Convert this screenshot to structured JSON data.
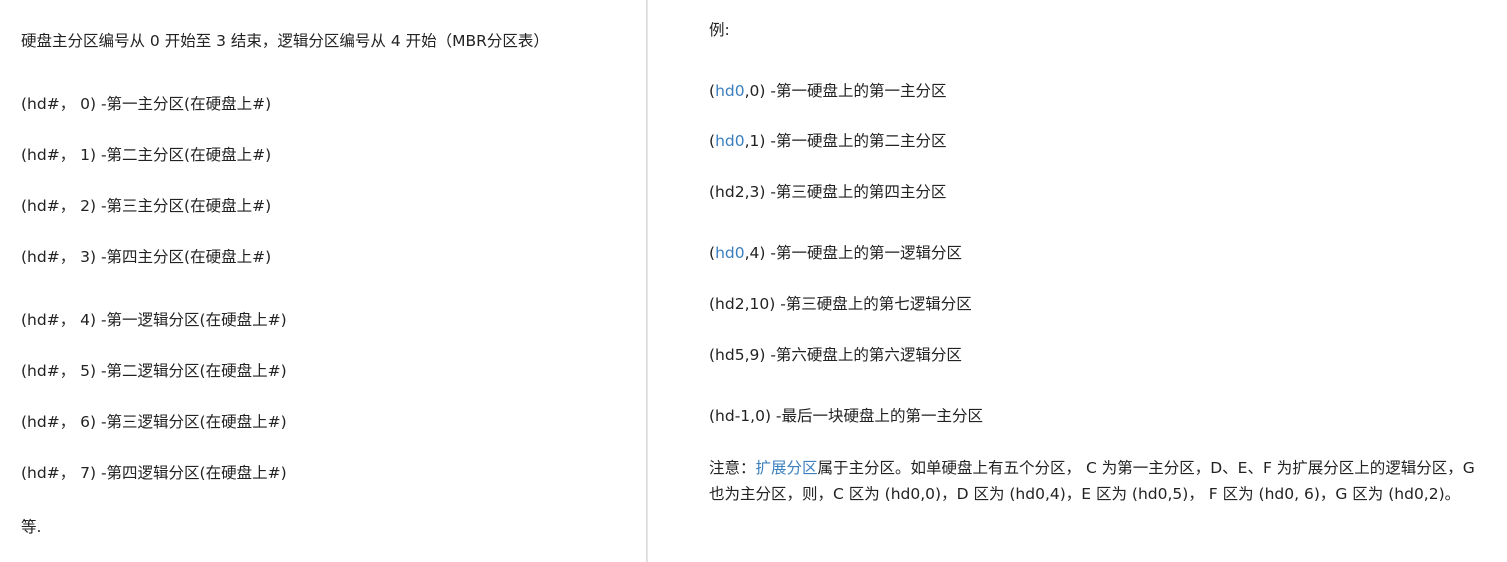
{
  "left": {
    "intro": "硬盘主分区编号从 0 开始至 3 结束，逻辑分区编号从 4 开始（MBR分区表）",
    "entries": [
      "(hd#， 0) -第一主分区(在硬盘上#)",
      "(hd#， 1) -第二主分区(在硬盘上#)",
      "(hd#， 2) -第三主分区(在硬盘上#)",
      "(hd#， 3) -第四主分区(在硬盘上#)",
      "(hd#， 4) -第一逻辑分区(在硬盘上#)",
      "(hd#， 5) -第二逻辑分区(在硬盘上#)",
      "(hd#， 6) -第三逻辑分区(在硬盘上#)",
      "(hd#， 7) -第四逻辑分区(在硬盘上#)"
    ],
    "etc": "等."
  },
  "right": {
    "example_label": "例:",
    "examples": [
      {
        "prefix": "(",
        "link": "hd0",
        "rest": ",0) -第一硬盘上的第一主分区"
      },
      {
        "prefix": "(",
        "link": "hd0",
        "rest": ",1) -第一硬盘上的第二主分区"
      },
      {
        "prefix": "",
        "link": "",
        "rest": "(hd2,3) -第三硬盘上的第四主分区"
      },
      {
        "prefix": "(",
        "link": "hd0",
        "rest": ",4) -第一硬盘上的第一逻辑分区"
      },
      {
        "prefix": "",
        "link": "",
        "rest": "(hd2,10) -第三硬盘上的第七逻辑分区"
      },
      {
        "prefix": "",
        "link": "",
        "rest": "(hd5,9) -第六硬盘上的第六逻辑分区"
      },
      {
        "prefix": "",
        "link": "",
        "rest": "(hd-1,0) -最后一块硬盘上的第一主分区"
      }
    ],
    "note": {
      "label": "注意：",
      "link": "扩展分区",
      "text": "属于主分区。如单硬盘上有五个分区， C 为第一主分区，D、E、F 为扩展分区上的逻辑分区，G 也为主分区，则，C 区为 (hd0,0)，D 区为 (hd0,4)，E 区为 (hd0,5)， F 区为 (hd0, 6)，G 区为 (hd0,2)。"
    },
    "colors": {
      "link": "#3b7fbf",
      "text": "#222222",
      "divider": "#d6d6d6"
    }
  }
}
